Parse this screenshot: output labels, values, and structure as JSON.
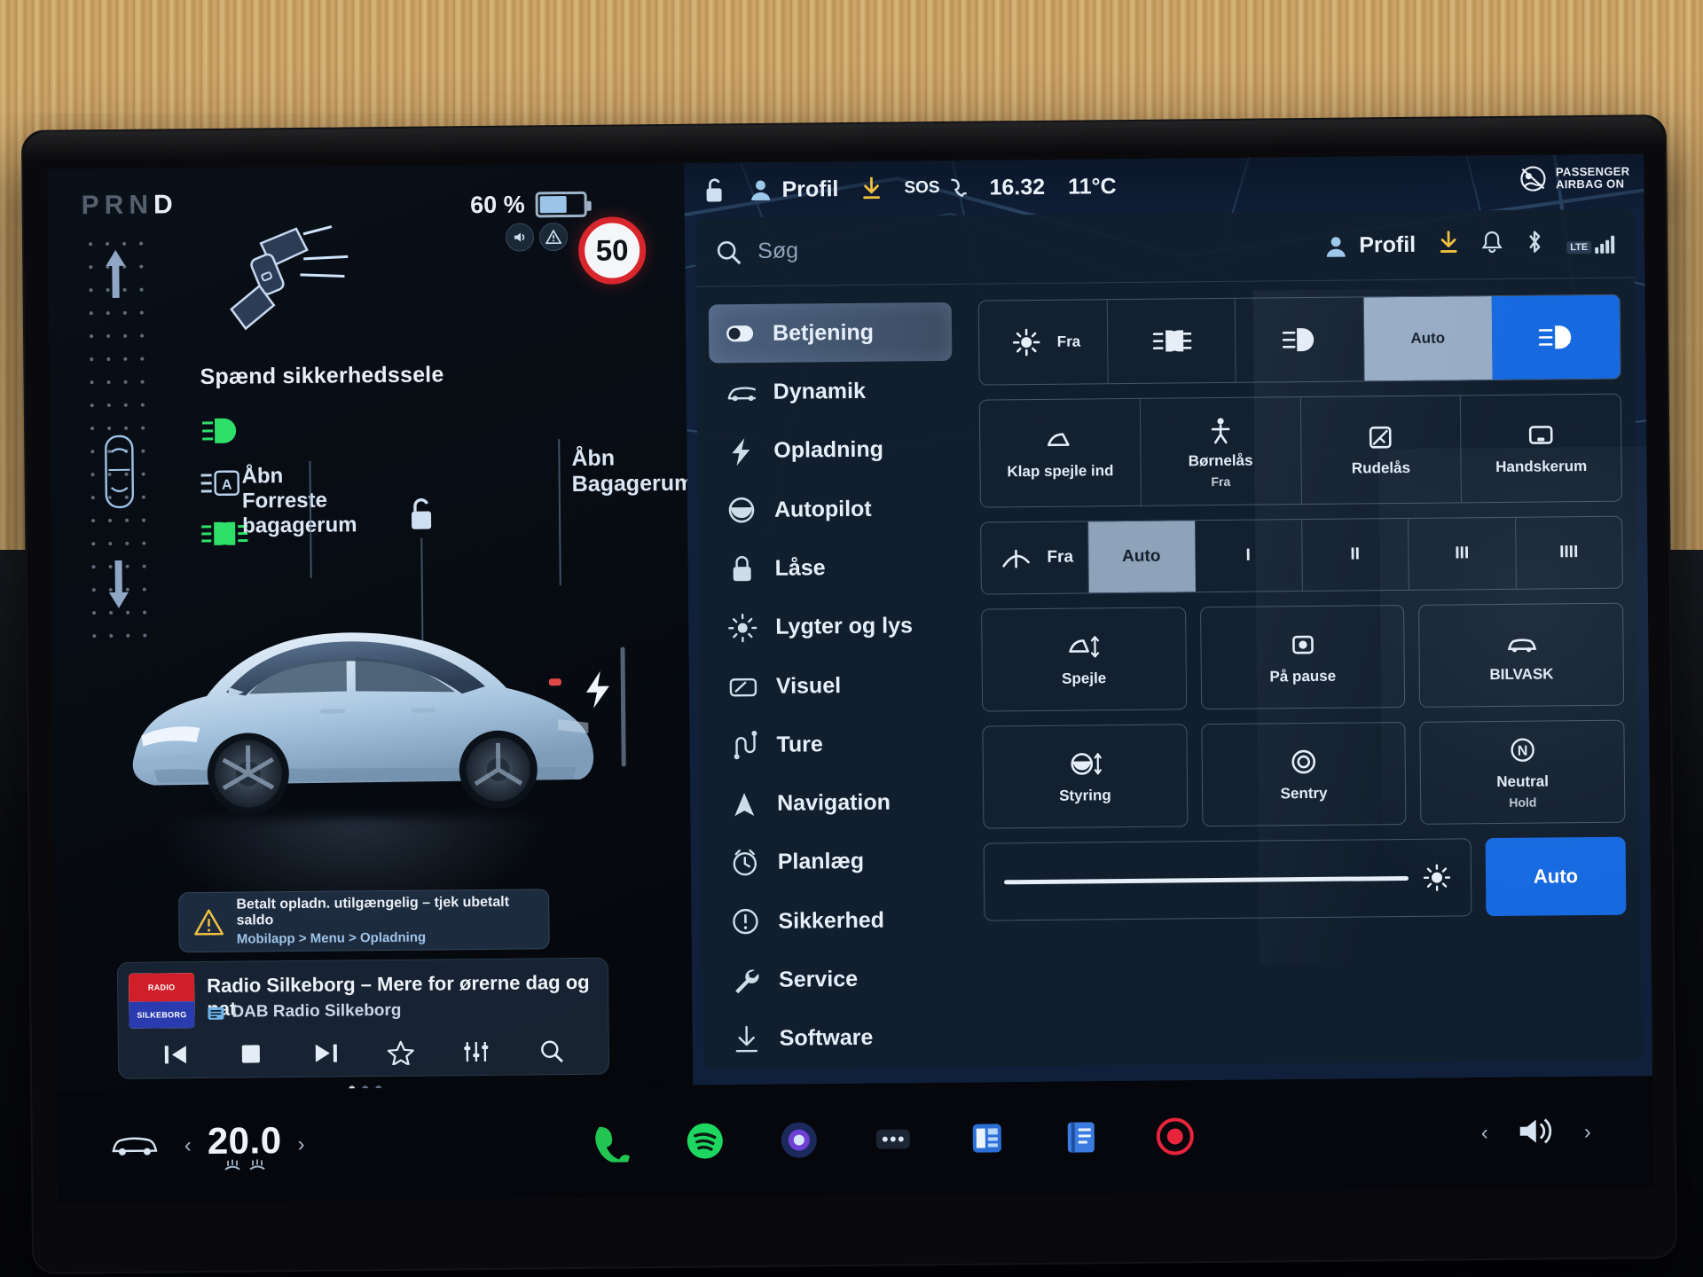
{
  "driver": {
    "gear_indicator": "PRND",
    "gear_selected": "D",
    "seatbelt_warning": "Spænd sikkerhedssele",
    "indicators": {
      "open_label": "Åbn",
      "front_label": "Forreste",
      "frunk_label": "bagagerum",
      "trunk_label_line1": "Åbn",
      "trunk_label_line2": "Bagagerum"
    },
    "battery_percent": "60 %",
    "battery_level": 58,
    "speed_limit": "50",
    "alert": {
      "line1": "Betalt opladn. utilgængelig – tjek ubetalt saldo",
      "line2": "Mobilapp > Menu > Opladning"
    }
  },
  "media": {
    "art_top": "RADIO",
    "art_bottom": "SILKEBORG",
    "title": "Radio Silkeborg – Mere for ørerne dag og nat",
    "source": "DAB Radio Silkeborg",
    "controls": [
      "previous-track",
      "stop",
      "next-track",
      "favorite",
      "equalizer",
      "search"
    ]
  },
  "statusbar": {
    "profile": "Profil",
    "time": "16.32",
    "temperature": "11°C",
    "sos": "SOS",
    "airbag_line1": "PASSENGER",
    "airbag_line2": "AIRBAG ON"
  },
  "settings": {
    "search_placeholder": "Søg",
    "search_value": "",
    "profile": "Profil",
    "network": "LTE",
    "menu": [
      {
        "label": "Betjening",
        "icon": "toggle-icon",
        "active": true
      },
      {
        "label": "Dynamik",
        "icon": "car-icon",
        "active": false
      },
      {
        "label": "Opladning",
        "icon": "bolt-icon",
        "active": false
      },
      {
        "label": "Autopilot",
        "icon": "steering-icon",
        "active": false
      },
      {
        "label": "Låse",
        "icon": "lock-icon",
        "active": false
      },
      {
        "label": "Lygter og lys",
        "icon": "sun-icon",
        "active": false
      },
      {
        "label": "Visuel",
        "icon": "display-icon",
        "active": false
      },
      {
        "label": "Ture",
        "icon": "trip-icon",
        "active": false
      },
      {
        "label": "Navigation",
        "icon": "navigation-icon",
        "active": false
      },
      {
        "label": "Planlæg",
        "icon": "clock-icon",
        "active": false
      },
      {
        "label": "Sikkerhed",
        "icon": "alert-icon",
        "active": false
      },
      {
        "label": "Service",
        "icon": "wrench-icon",
        "active": false
      },
      {
        "label": "Software",
        "icon": "download-icon",
        "active": false
      }
    ],
    "lights_row": [
      {
        "label": "Fra",
        "icon": "light-off-icon",
        "state": "normal"
      },
      {
        "label": "",
        "icon": "parking-lights-icon",
        "state": "normal"
      },
      {
        "label": "",
        "icon": "low-beam-icon",
        "state": "normal"
      },
      {
        "label": "Auto",
        "icon": "",
        "state": "selected"
      },
      {
        "label": "",
        "icon": "auto-beam-icon",
        "state": "accent"
      }
    ],
    "mirror_row": [
      {
        "label": "Klap spejle ind",
        "sub": "",
        "icon": "mirror-fold-icon"
      },
      {
        "label": "Børnelås",
        "sub": "Fra",
        "icon": "child-lock-icon"
      },
      {
        "label": "Rudelås",
        "sub": "",
        "icon": "window-lock-icon"
      },
      {
        "label": "Handskerum",
        "sub": "",
        "icon": "glovebox-icon"
      }
    ],
    "wiper_row": [
      {
        "label": "Fra",
        "icon": "wiper-icon",
        "state": "normal"
      },
      {
        "label": "Auto",
        "icon": "",
        "state": "selected"
      },
      {
        "label": "I",
        "icon": "",
        "state": "normal"
      },
      {
        "label": "II",
        "icon": "",
        "state": "normal"
      },
      {
        "label": "III",
        "icon": "",
        "state": "normal"
      },
      {
        "label": "IIII",
        "icon": "",
        "state": "normal"
      }
    ],
    "tiles": [
      {
        "label": "Spejle",
        "sub": "",
        "icon": "mirror-adjust-icon"
      },
      {
        "label": "På pause",
        "sub": "",
        "icon": "dashcam-icon"
      },
      {
        "label": "BILVASK",
        "sub": "",
        "icon": "carwash-icon"
      },
      {
        "label": "Styring",
        "sub": "",
        "icon": "steering-adjust-icon"
      },
      {
        "label": "Sentry",
        "sub": "",
        "icon": "sentry-icon"
      },
      {
        "label": "Neutral",
        "sub": "Hold",
        "icon": "neutral-icon"
      }
    ],
    "brightness": {
      "value": 92,
      "icon": "brightness-icon"
    },
    "auto_button": "Auto"
  },
  "appbar": {
    "car_icon": "car-icon",
    "temperature": "20.0",
    "prev_chevron": "‹",
    "next_chevron": "›",
    "apps": [
      "phone-icon",
      "spotify-icon",
      "camera-icon",
      "more-icon",
      "calendar-icon",
      "manual-icon",
      "record-icon"
    ],
    "volume_icon": "volume-icon"
  },
  "colors": {
    "accent_blue": "#1769e0",
    "selected": "#bed4f0",
    "green": "#2ee06a",
    "red": "#d8272c",
    "amber": "#f0c040"
  }
}
